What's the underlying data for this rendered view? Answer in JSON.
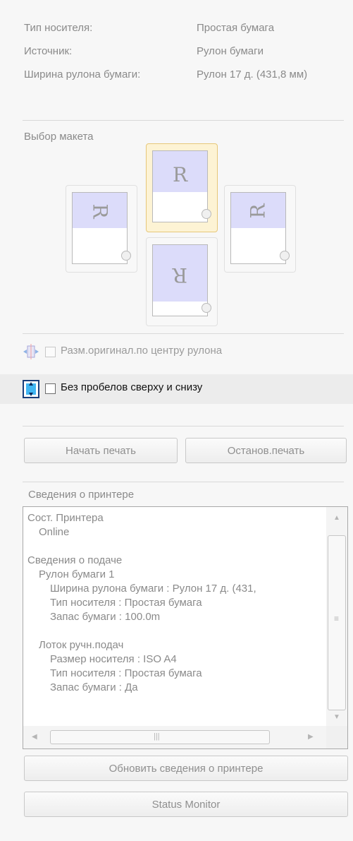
{
  "info": {
    "media_type_label": "Тип носителя:",
    "media_type_value": "Простая бумага",
    "source_label": "Источник:",
    "source_value": "Рулон бумаги",
    "roll_width_label": "Ширина рулона бумаги:",
    "roll_width_value": "Рулон 17 д. (431,8 мм)"
  },
  "layout": {
    "label": "Выбор макета",
    "letter": "R",
    "selected": "top"
  },
  "options": {
    "center_label": "Разм.оригинал.по центру рулона",
    "center_checked": false,
    "borderless_label": "Без пробелов сверху и снизу",
    "borderless_checked": false
  },
  "print_buttons": {
    "start": "Начать печать",
    "stop": "Останов.печать"
  },
  "printer_info": {
    "label": "Сведения о принтере",
    "lines": [
      "Сост. Принтера",
      "Online",
      "",
      "Сведения о подаче",
      "Рулон бумаги 1",
      "Ширина рулона бумаги : Рулон 17 д. (431,",
      "Тип носителя : Простая бумага",
      "Запас бумаги : 100.0m",
      "",
      "Лоток ручн.подач",
      "Размер носителя : ISO A4",
      "Тип носителя : Простая бумага",
      "Запас бумаги : Да"
    ]
  },
  "bottom_buttons": {
    "refresh": "Обновить сведения о принтере",
    "status_monitor": "Status Monitor"
  },
  "icons": {
    "center_icon": "center-on-roll-icon",
    "borderless_icon": "borderless-top-bottom-icon"
  }
}
